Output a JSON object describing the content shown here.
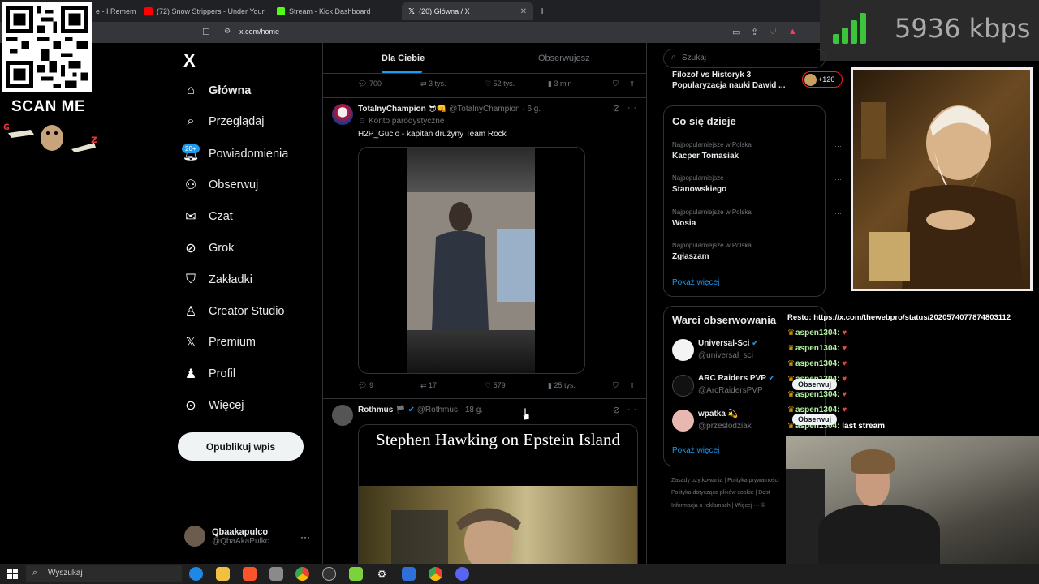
{
  "browser": {
    "tabs": [
      {
        "label": "e - I Remem",
        "icon_color": "#888888"
      },
      {
        "label": "(72) Snow Strippers - Under Your",
        "icon_color": "#ff0000"
      },
      {
        "label": "Stream - Kick Dashboard",
        "icon_color": "#53fc18"
      },
      {
        "label": "(20) Główna / X",
        "icon_color": "#ffffff"
      }
    ],
    "url": "x.com/home"
  },
  "overlay": {
    "scan_me": "SCAN ME",
    "bitrate": "5936 kbps",
    "signal_color": "#3cc43c"
  },
  "nav": {
    "logo": "X",
    "items": [
      {
        "label": "Główna",
        "icon": "home-icon"
      },
      {
        "label": "Przeglądaj",
        "icon": "search-icon"
      },
      {
        "label": "Powiadomienia",
        "icon": "bell-icon"
      },
      {
        "label": "Obserwuj",
        "icon": "add-user-icon"
      },
      {
        "label": "Czat",
        "icon": "mail-icon"
      },
      {
        "label": "Grok",
        "icon": "grok-icon"
      },
      {
        "label": "Zakładki",
        "icon": "bookmark-icon"
      },
      {
        "label": "Creator Studio",
        "icon": "creator-icon"
      },
      {
        "label": "Premium",
        "icon": "x-icon"
      },
      {
        "label": "Profil",
        "icon": "profile-icon"
      },
      {
        "label": "Więcej",
        "icon": "more-icon"
      }
    ],
    "notif_badge": "20+",
    "post_button": "Opublikuj wpis",
    "profile_name": "Qbaakapulco",
    "profile_handle": "@QbaAkaPulko"
  },
  "timeline": {
    "tab_for_you": "Dla Ciebie",
    "tab_following": "Obserwujesz",
    "prev_actions": {
      "replies": "700",
      "reposts": "3 tys.",
      "likes": "52 tys.",
      "views": "3 mln"
    },
    "tweet1": {
      "name": "TotalnyChampion 😎👊",
      "handle": "@TotalnyChampion · 6 g.",
      "label": "Konto parodystyczne",
      "text": "H2P_Gucio - kapitan drużyny Team Rock",
      "actions": {
        "replies": "9",
        "reposts": "17",
        "likes": "579",
        "views": "25 tys."
      }
    },
    "tweet2": {
      "name": "Rothmus",
      "handle": "@Rothmus · 18 g.",
      "media_title": "Stephen Hawking on Epstein Island"
    }
  },
  "sidebar": {
    "search_placeholder": "Szukaj",
    "live_title": "Filozof vs Historyk 3 Popularyzacja nauki Dawid ...",
    "live_count": "+126",
    "trends_title": "Co się dzieje",
    "trends": [
      {
        "meta": "Najpopularniejsze w Polska",
        "name": "Kacper Tomasiak"
      },
      {
        "meta": "Najpopularniejsze",
        "name": "Stanowskiego"
      },
      {
        "meta": "Najpopularniejsze w Polska",
        "name": "Wosia"
      },
      {
        "meta": "Najpopularniejsze w Polska",
        "name": "Zgłaszam"
      }
    ],
    "show_more": "Pokaż więcej",
    "who_title": "Warci obserwowania",
    "who": [
      {
        "name": "Universal-Sci",
        "handle": "@universal_sci"
      },
      {
        "name": "ARC Raiders PVP",
        "handle": "@ArcRaidersPVP"
      },
      {
        "name": "wpatka 💫",
        "handle": "@przeslodziak"
      }
    ],
    "who_show_more": "Pokaż więcej",
    "footer1": "Zasady użytkowania  |  Polityka prywatności",
    "footer2": "Polityka dotycząca plików cookie  |  Dost",
    "footer3": "Informacja o reklamach  |  Więcej ···  ©"
  },
  "chat": {
    "line0": "Resto: https://x.com/thewebpro/status/2020574077874803112",
    "user": "aspen1304:",
    "follow": "Obserwuj",
    "last": "last stream"
  },
  "taskbar": {
    "search": "Wyszukaj"
  }
}
